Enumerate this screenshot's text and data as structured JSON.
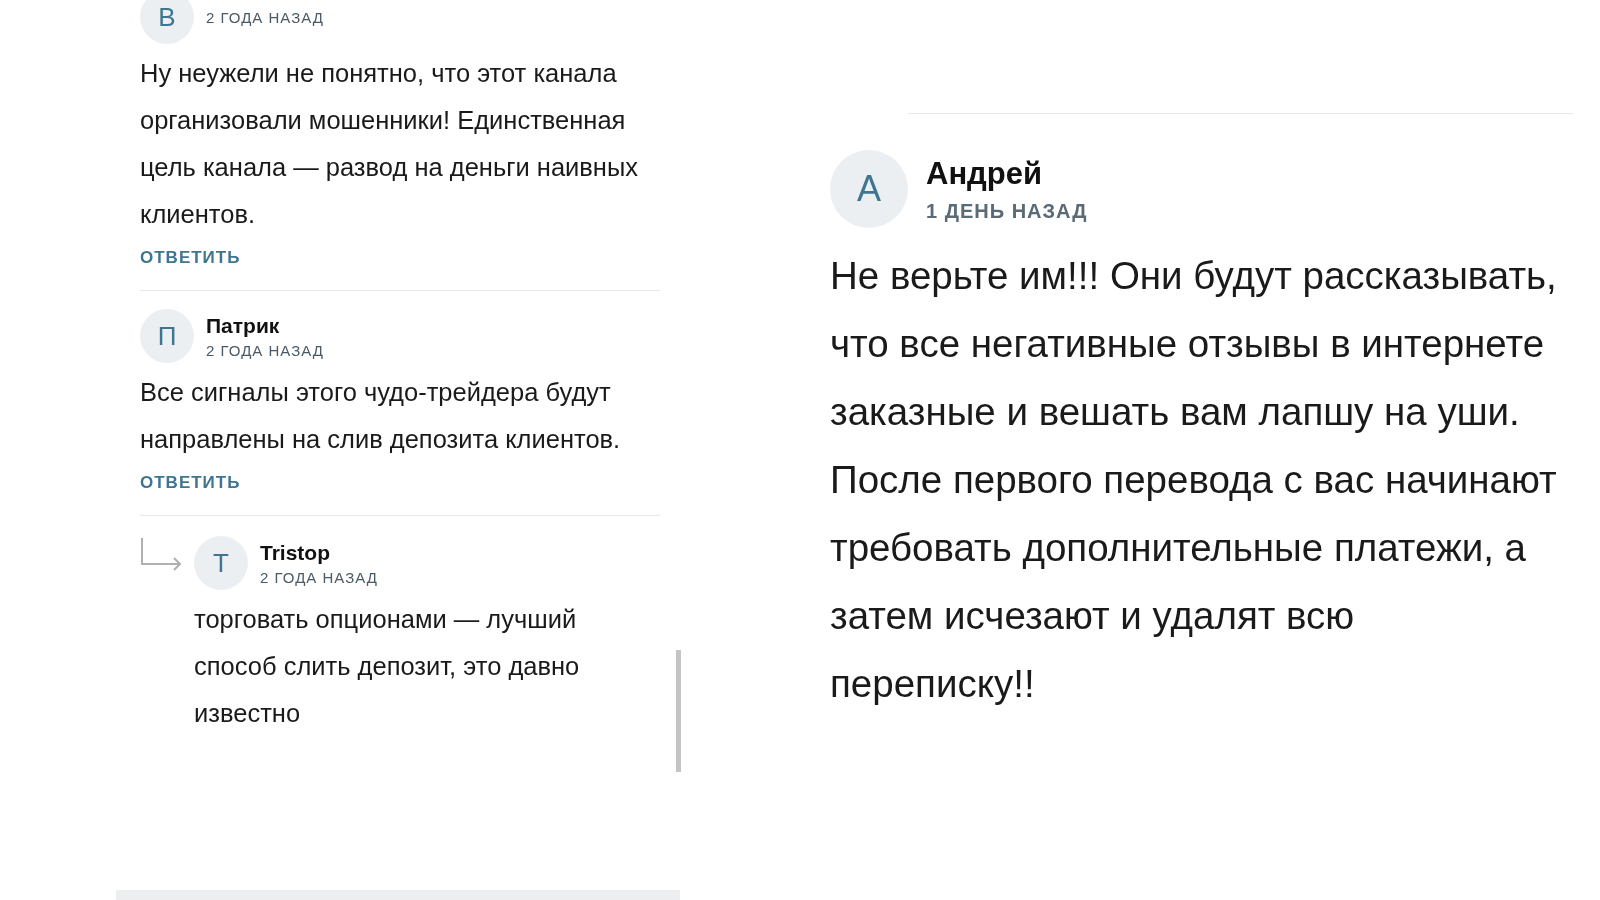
{
  "left_thread": {
    "comments": [
      {
        "avatar_letter": "B",
        "time": "2 ГОДА НАЗАД",
        "text": "Ну неужели не понятно, что этот канала организовали мошенники! Единственная цель канала — развод на деньги наивных клиентов.",
        "reply_label": "ОТВЕТИТЬ"
      },
      {
        "avatar_letter": "П",
        "author": "Патрик",
        "time": "2 ГОДА НАЗАД",
        "text": "Все сигналы этого чудо-трейдера будут направлены на слив депозита клиентов.",
        "reply_label": "ОТВЕТИТЬ",
        "replies": [
          {
            "avatar_letter": "T",
            "author": "Tristop",
            "time": "2 ГОДА НАЗАД",
            "text": "торговать опционами — лучший способ слить депозит, это давно известно"
          }
        ]
      }
    ]
  },
  "right_comment": {
    "avatar_letter": "А",
    "author": "Андрей",
    "time": "1 ДЕНЬ НАЗАД",
    "text": "Не верьте им!!! Они будут рассказывать, что все негативные отзывы в интернете заказные и вешать вам лапшу на уши. После первого перевода с вас начинают требовать дополнительные платежи, а затем исчезают и удалят всю переписку!!"
  }
}
